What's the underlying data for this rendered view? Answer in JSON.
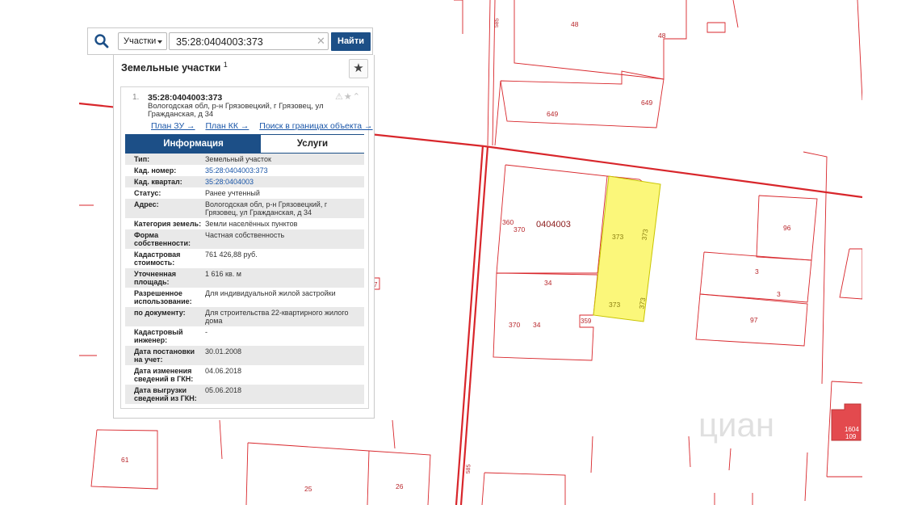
{
  "search": {
    "type_label": "Участки",
    "query": "35:28:0404003:373",
    "find_label": "Найти"
  },
  "panel": {
    "title": "Земельные участки",
    "count": "1"
  },
  "result": {
    "num": "1.",
    "cadastral_number": "35:28:0404003:373",
    "address": "Вологодская обл, р-н Грязовецкий, г Грязовец, ул Гражданская, д 34",
    "links": [
      "План ЗУ →",
      "План КК →",
      "Поиск в границах объекта →"
    ],
    "tabs": [
      "Информация",
      "Услуги"
    ],
    "rows": [
      {
        "k": "Тип:",
        "v": "Земельный участок"
      },
      {
        "k": "Кад. номер:",
        "v": "35:28:0404003:373"
      },
      {
        "k": "Кад. квартал:",
        "v": "35:28:0404003"
      },
      {
        "k": "Статус:",
        "v": "Ранее учтенный"
      },
      {
        "k": "Адрес:",
        "v": "Вологодская обл, р-н Грязовецкий, г Грязовец, ул Гражданская, д 34"
      },
      {
        "k": "Категория земель:",
        "v": "Земли населённых пунктов"
      },
      {
        "k": "Форма собственности:",
        "v": "Частная собственность"
      },
      {
        "k": "Кадастровая стоимость:",
        "v": "761 426,88 руб."
      },
      {
        "k": "Уточненная площадь:",
        "v": "1 616 кв. м"
      },
      {
        "k": "Разрешенное использование:",
        "v": "Для индивидуальной жилой застройки"
      },
      {
        "k": "по документу:",
        "v": "Для строительства 22-квартирного жилого дома"
      },
      {
        "k": "Кадастровый инженер:",
        "v": "-"
      },
      {
        "k": "Дата постановки на учет:",
        "v": "30.01.2008"
      },
      {
        "k": "Дата изменения сведений в ГКН:",
        "v": "04.06.2018"
      },
      {
        "k": "Дата выгрузки сведений из ГКН:",
        "v": "05.06.2018"
      }
    ]
  },
  "map": {
    "labels": {
      "l48a": "48",
      "l48b": "48",
      "l649a": "649",
      "l649b": "649",
      "l360": "360",
      "l370a": "370",
      "quarter": "0404003",
      "l373a": "373",
      "l373b": "373",
      "l373c": "373",
      "l373d": "373",
      "l34a": "34",
      "l34b": "34",
      "l370b": "370",
      "l359": "359",
      "l96": "96",
      "l3a": "3",
      "l3b": "3",
      "l97": "97",
      "l61": "61",
      "l25": "25",
      "l26": "26",
      "l585a": "585",
      "l585b": "585",
      "l1604": "1604",
      "l109": "109",
      "l7": "7"
    },
    "watermark": "циан",
    "colors": {
      "boundary": "#d8262b",
      "selected_fill": "#fbf77a",
      "highlight": "#e0373b"
    }
  }
}
